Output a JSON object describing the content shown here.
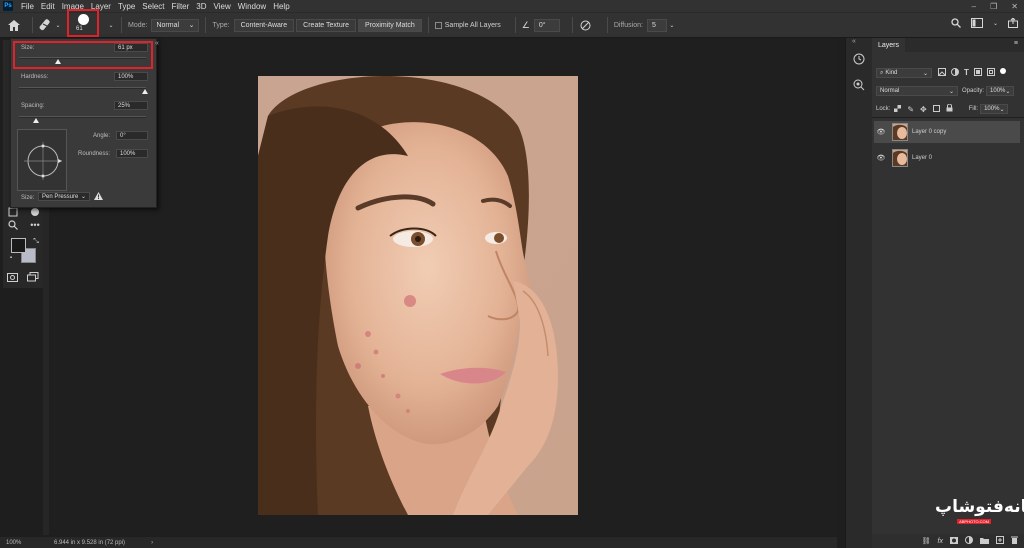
{
  "menubar": {
    "logo": "Ps",
    "items": [
      "File",
      "Edit",
      "Image",
      "Layer",
      "Type",
      "Select",
      "Filter",
      "3D",
      "View",
      "Window",
      "Help"
    ],
    "window_controls": [
      "–",
      "❐",
      "✕"
    ]
  },
  "options": {
    "brush_size": "61",
    "mode_label": "Mode:",
    "mode_value": "Normal",
    "type_label": "Type:",
    "type_buttons": [
      "Content-Aware",
      "Create Texture",
      "Proximity Match"
    ],
    "sample_all": "Sample All Layers",
    "angle_value": "0°",
    "diffusion_label": "Diffusion:",
    "diffusion_value": "5"
  },
  "brush_popup": {
    "size_label": "Size:",
    "size_value": "61 px",
    "hardness_label": "Hardness:",
    "hardness_value": "100%",
    "spacing_label": "Spacing:",
    "spacing_value": "25%",
    "angle_label": "Angle:",
    "angle_value": "0°",
    "roundness_label": "Roundness:",
    "roundness_value": "100%",
    "pressure_label": "Size:",
    "pressure_value": "Pen Pressure"
  },
  "status": {
    "zoom": "100%",
    "doc_info": "6.944 in x 9.528 in (72 ppi)"
  },
  "layers_panel": {
    "tab": "Layers",
    "filter_kind": "Kind",
    "blend_mode": "Normal",
    "opacity_label": "Opacity:",
    "opacity_value": "100%",
    "lock_label": "Lock:",
    "fill_label": "Fill:",
    "fill_value": "100%",
    "layers": [
      {
        "name": "Layer 0 copy",
        "selected": true
      },
      {
        "name": "Layer 0",
        "selected": false
      }
    ]
  },
  "watermark": {
    "text": "خانه‌فتوشاپ",
    "small": "ABPHOTO.COM"
  }
}
